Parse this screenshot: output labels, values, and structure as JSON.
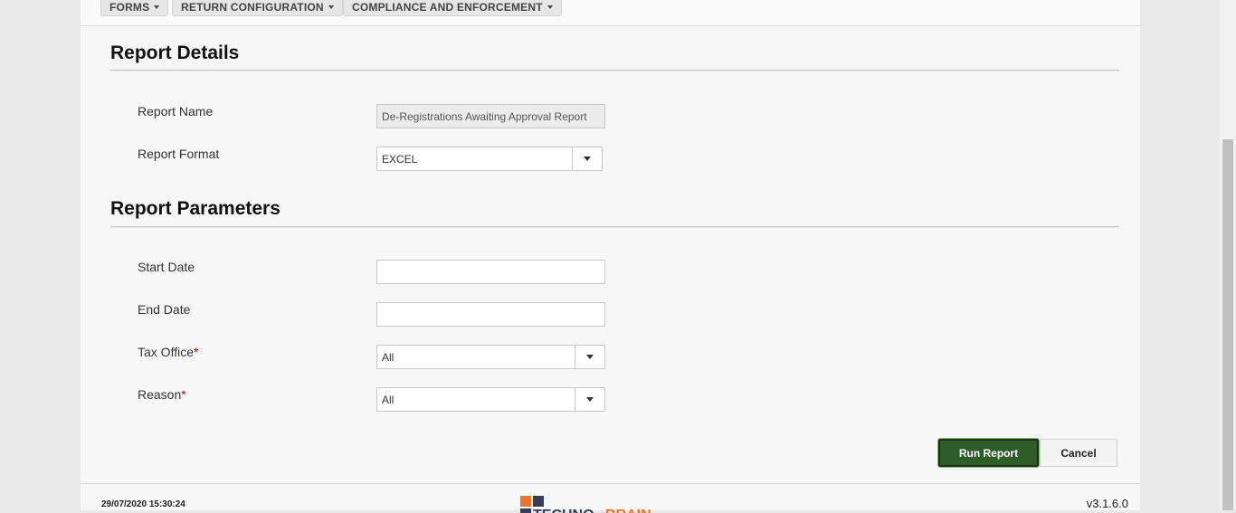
{
  "nav": {
    "items": [
      {
        "label": "FORMS"
      },
      {
        "label": "RETURN CONFIGURATION"
      },
      {
        "label": "COMPLIANCE AND ENFORCEMENT"
      }
    ]
  },
  "details": {
    "title": "Report Details",
    "report_name_label": "Report Name",
    "report_name_value": "De-Registrations Awaiting Approval Report",
    "report_format_label": "Report Format",
    "report_format_value": "EXCEL"
  },
  "params": {
    "title": "Report Parameters",
    "start_date_label": "Start Date",
    "start_date_value": "",
    "end_date_label": "End Date",
    "end_date_value": "",
    "tax_office_label": "Tax Office",
    "tax_office_value": "All",
    "reason_label": "Reason",
    "reason_value": "All",
    "required_marker": "*"
  },
  "actions": {
    "run_label": "Run Report",
    "cancel_label": "Cancel"
  },
  "footer": {
    "datetime": "29/07/2020 15:30:24",
    "version": "v3.1.6.0",
    "logo_text": "TECHNO BRAIN"
  },
  "colors": {
    "run_button": "#2f5d2a",
    "required": "#cc0000",
    "logo_orange": "#e8762b",
    "logo_navy": "#3c3c5a"
  }
}
